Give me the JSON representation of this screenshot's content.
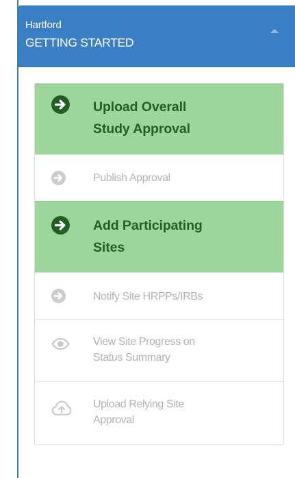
{
  "header": {
    "org": "Hartford",
    "title": "GETTING STARTED"
  },
  "steps": [
    {
      "label_lines": [
        "Upload Overall",
        "Study Approval"
      ],
      "status": "active",
      "icon": "arrow-circle-right-icon"
    },
    {
      "label_lines": [
        "Publish Approval"
      ],
      "status": "inactive",
      "icon": "arrow-circle-right-icon"
    },
    {
      "label_lines": [
        "Add Participating",
        "Sites"
      ],
      "status": "active",
      "icon": "arrow-circle-right-icon"
    },
    {
      "label_lines": [
        "Notify Site HRPPs/IRBs"
      ],
      "status": "inactive",
      "icon": "arrow-circle-right-icon"
    },
    {
      "label_lines": [
        "View Site Progress on",
        "Status Summary"
      ],
      "status": "inactive",
      "icon": "eye-icon"
    },
    {
      "label_lines": [
        "Upload Relying Site",
        "Approval"
      ],
      "status": "inactive",
      "icon": "cloud-upload-icon"
    }
  ],
  "colors": {
    "header_bg": "#3a7fc6",
    "active_bg": "#9cd69a",
    "active_text": "#225e26",
    "inactive_text": "#b3b3b3",
    "inactive_icon": "#cccccc"
  }
}
